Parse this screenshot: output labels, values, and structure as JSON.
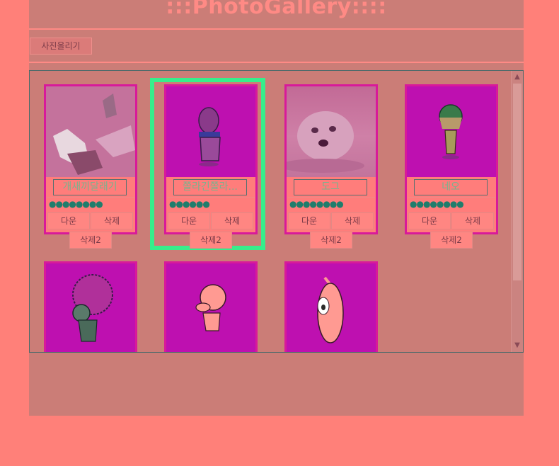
{
  "header": {
    "title": ":::PhotoGallery::::"
  },
  "toolbar": {
    "upload_label": "사진올리기"
  },
  "gallery": {
    "cards": [
      {
        "name": "개새끼달래기",
        "stars": "●●●●●●●●",
        "down_label": "다운",
        "delete_label": "삭제",
        "delete2_label": "삭제2",
        "image": "dog-cat-photo"
      },
      {
        "name": "쫄라긴쫄라...",
        "stars": "●●●●●●",
        "down_label": "다운",
        "delete_label": "삭제",
        "delete2_label": "삭제2",
        "image": "cartoon-character",
        "selected": true
      },
      {
        "name": "도그",
        "stars": "●●●●●●●●",
        "down_label": "다운",
        "delete_label": "삭제",
        "delete2_label": "삭제2",
        "image": "puppy-photo"
      },
      {
        "name": "네오",
        "stars": "●●●●●●●●",
        "down_label": "다운",
        "delete_label": "삭제",
        "delete2_label": "삭제2",
        "image": "cartoon-character"
      }
    ],
    "row2_images": [
      "cartoon-afro-character",
      "cartoon-round-character",
      "cartoon-peach-character"
    ]
  },
  "colors": {
    "background": "#ff8079",
    "panel": "#cb7d77",
    "selected": "#37ee8b",
    "card_border": "#d81a9a"
  }
}
